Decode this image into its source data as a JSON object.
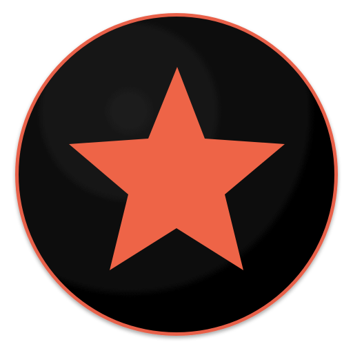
{
  "icon": {
    "name": "star-icon",
    "badge_name": "circle-badge",
    "colors": {
      "accent": "#EE6447",
      "ring": "#E8604A",
      "background": "#000000",
      "background_highlight": "#1C1C1C",
      "page": "#FFFFFF"
    }
  }
}
